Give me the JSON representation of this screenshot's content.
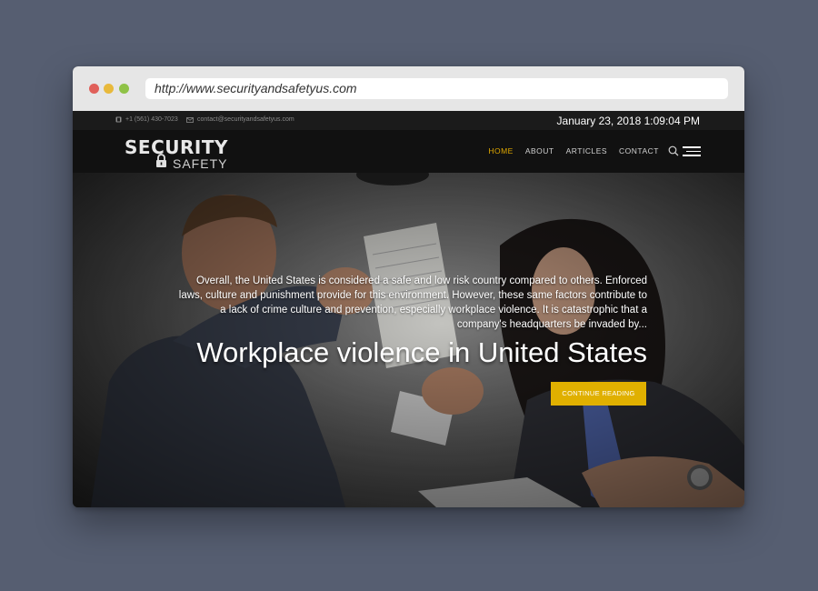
{
  "browser": {
    "url": "http://www.securityandsafetyus.com"
  },
  "topbar": {
    "phone": "+1 (561) 430-7023",
    "email": "contact@securityandsafetyus.com",
    "datetime": "January 23, 2018  1:09:04 PM"
  },
  "header": {
    "logo_top": "SECURITY",
    "logo_bottom": "SAFETY",
    "nav": [
      {
        "label": "HOME",
        "active": true
      },
      {
        "label": "ABOUT",
        "active": false
      },
      {
        "label": "ARTICLES",
        "active": false
      },
      {
        "label": "CONTACT",
        "active": false
      }
    ]
  },
  "hero": {
    "excerpt": "Overall, the United States is considered a safe and low risk country compared to others. Enforced laws, culture and punishment provide for this environment. However, these same factors contribute to a lack of crime culture and prevention, especially workplace violence. It is catastrophic that a company's headquarters be invaded by...",
    "title": "Workplace violence in United States",
    "cta_label": "CONTINUE READING"
  },
  "colors": {
    "accent": "#e0b000",
    "nav_active": "#e0a800",
    "navbar_bg": "#111111",
    "desktop_bg": "#565e71"
  }
}
